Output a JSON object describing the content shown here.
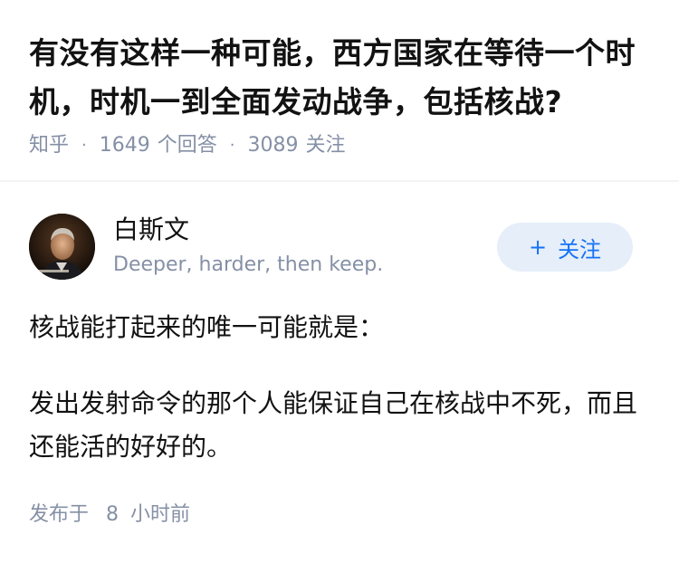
{
  "question": {
    "title": "有没有这样一种可能，西方国家在等待一个时机，时机一到全面发动战争，包括核战?",
    "source": "知乎",
    "answer_count": "1649",
    "answer_label": "个回答",
    "follower_count": "3089",
    "follower_label": "关注"
  },
  "author": {
    "name": "白斯文",
    "bio": "Deeper, harder, then keep.",
    "avatar_icon": "avatar-portrait",
    "follow_label": "关注",
    "follow_icon": "plus-icon"
  },
  "answer": {
    "paragraphs": [
      "核战能打起来的唯一可能就是：",
      "发出发射命令的那个人能保证自己在核战中不死，而且还能活的好好的。"
    ]
  },
  "footer": {
    "posted_label": "发布于",
    "posted_value": "8",
    "posted_unit": "小时前"
  },
  "colors": {
    "title": "#121212",
    "meta": "#8590a6",
    "accent": "#1772f6",
    "follow_bg": "#e5eef9"
  }
}
